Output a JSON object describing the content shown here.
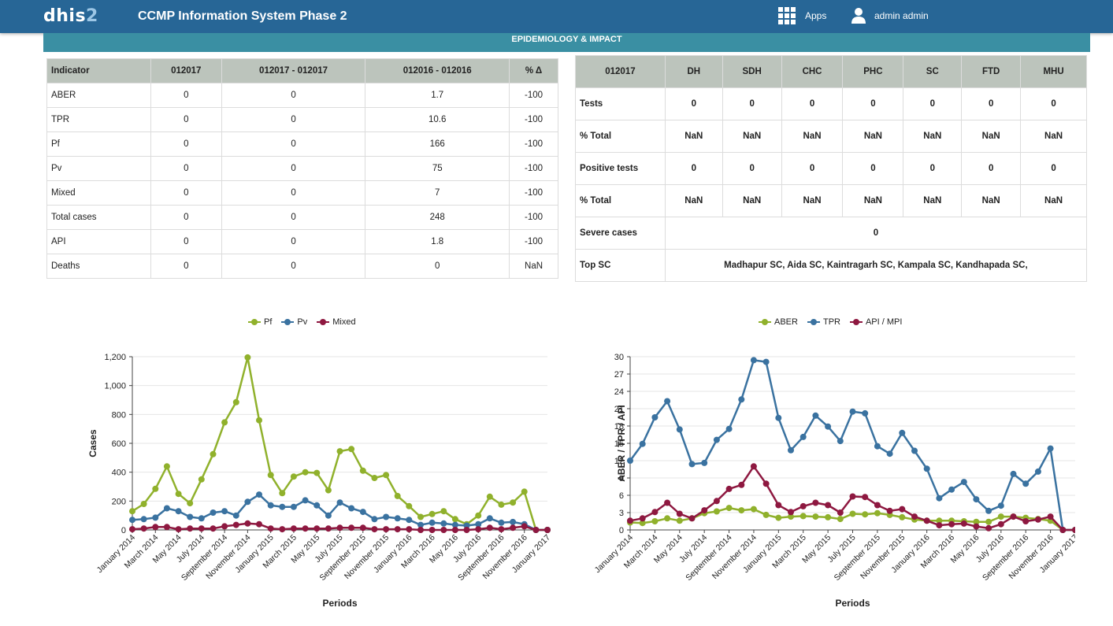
{
  "header": {
    "logo_text": "dhis",
    "logo_digit": "2",
    "title": "CCMP Information System Phase 2",
    "apps_label": "Apps",
    "user_label": "admin admin"
  },
  "banner": {
    "title": "EPIDEMIOLOGY & IMPACT"
  },
  "indicator_table": {
    "headers": [
      "Indicator",
      "012017",
      "012017 - 012017",
      "012016 - 012016",
      "% Δ"
    ],
    "rows": [
      [
        "ABER",
        "0",
        "0",
        "1.7",
        "-100"
      ],
      [
        "TPR",
        "0",
        "0",
        "10.6",
        "-100"
      ],
      [
        "Pf",
        "0",
        "0",
        "166",
        "-100"
      ],
      [
        "Pv",
        "0",
        "0",
        "75",
        "-100"
      ],
      [
        "Mixed",
        "0",
        "0",
        "7",
        "-100"
      ],
      [
        "Total cases",
        "0",
        "0",
        "248",
        "-100"
      ],
      [
        "API",
        "0",
        "0",
        "1.8",
        "-100"
      ],
      [
        "Deaths",
        "0",
        "0",
        "0",
        "NaN"
      ]
    ]
  },
  "facility_table": {
    "headers": [
      "012017",
      "DH",
      "SDH",
      "CHC",
      "PHC",
      "SC",
      "FTD",
      "MHU"
    ],
    "rows": [
      [
        "Tests",
        "0",
        "0",
        "0",
        "0",
        "0",
        "0",
        "0"
      ],
      [
        "% Total",
        "NaN",
        "NaN",
        "NaN",
        "NaN",
        "NaN",
        "NaN",
        "NaN"
      ],
      [
        "Positive tests",
        "0",
        "0",
        "0",
        "0",
        "0",
        "0",
        "0"
      ],
      [
        "% Total",
        "NaN",
        "NaN",
        "NaN",
        "NaN",
        "NaN",
        "NaN",
        "NaN"
      ]
    ],
    "severe_label": "Severe cases",
    "severe_value": "0",
    "top_label": "Top SC",
    "top_value": "Madhapur SC, Aida SC, Kaintragarh SC, Kampala SC, Kandhapada SC,"
  },
  "chart_data": [
    {
      "type": "line",
      "xlabel": "Periods",
      "ylabel": "Cases",
      "ylim": [
        0,
        1200
      ],
      "yticks": [
        0,
        200,
        400,
        600,
        800,
        1000,
        1200
      ],
      "ytick_labels": [
        "0",
        "200",
        "400",
        "600",
        "800",
        "1,000",
        "1,200"
      ],
      "x_labels": [
        "January 2014",
        "March 2014",
        "May 2014",
        "July 2014",
        "September 2014",
        "November 2014",
        "January 2015",
        "March 2015",
        "May 2015",
        "July 2015",
        "September 2015",
        "November 2015",
        "January 2016",
        "March 2016",
        "May 2016",
        "July 2016",
        "September 2016",
        "November 2016",
        "January 2017"
      ],
      "legend_position": "top",
      "grid": true,
      "series": [
        {
          "name": "Pf",
          "color": "#90b12c",
          "values": [
            130,
            180,
            285,
            440,
            250,
            185,
            350,
            525,
            745,
            885,
            1195,
            760,
            380,
            255,
            370,
            400,
            395,
            275,
            545,
            560,
            410,
            360,
            380,
            235,
            165,
            90,
            110,
            130,
            75,
            40,
            100,
            230,
            175,
            190,
            265,
            0,
            0
          ]
        },
        {
          "name": "Pv",
          "color": "#3a72a0",
          "values": [
            70,
            75,
            85,
            150,
            130,
            90,
            80,
            120,
            130,
            100,
            195,
            245,
            170,
            160,
            160,
            205,
            170,
            100,
            190,
            150,
            125,
            75,
            90,
            80,
            70,
            35,
            50,
            45,
            35,
            30,
            40,
            80,
            50,
            55,
            40,
            0,
            0
          ]
        },
        {
          "name": "Mixed",
          "color": "#8e1840",
          "values": [
            5,
            10,
            20,
            20,
            5,
            10,
            10,
            10,
            25,
            35,
            45,
            40,
            10,
            5,
            10,
            10,
            10,
            10,
            15,
            15,
            15,
            5,
            5,
            5,
            5,
            0,
            0,
            0,
            0,
            0,
            5,
            15,
            5,
            15,
            25,
            0,
            0
          ]
        }
      ]
    },
    {
      "type": "line",
      "xlabel": "Periods",
      "ylabel": "ABER / TPR / API",
      "ylim": [
        0,
        30
      ],
      "yticks": [
        0,
        3,
        6,
        9,
        12,
        15,
        18,
        21,
        24,
        27,
        30
      ],
      "ytick_labels": [
        "0",
        "3",
        "6",
        "9",
        "12",
        "15",
        "18",
        "21",
        "24",
        "27",
        "30"
      ],
      "x_labels": [
        "January 2014",
        "March 2014",
        "May 2014",
        "July 2014",
        "September 2014",
        "November 2014",
        "January 2015",
        "March 2015",
        "May 2015",
        "July 2015",
        "September 2015",
        "November 2015",
        "January 2016",
        "March 2016",
        "May 2016",
        "July 2016",
        "September 2016",
        "November 2016",
        "January 2017"
      ],
      "legend_position": "top",
      "grid": true,
      "series": [
        {
          "name": "ABER",
          "color": "#90b12c",
          "values": [
            1.3,
            1.2,
            1.5,
            2.0,
            1.6,
            2.0,
            2.9,
            3.2,
            3.8,
            3.4,
            3.6,
            2.6,
            2.1,
            2.3,
            2.4,
            2.3,
            2.2,
            1.9,
            2.8,
            2.7,
            2.9,
            2.6,
            2.2,
            1.8,
            1.6,
            1.6,
            1.6,
            1.5,
            1.4,
            1.4,
            2.3,
            2.3,
            2.1,
            1.9,
            1.6,
            0,
            0
          ]
        },
        {
          "name": "TPR",
          "color": "#3a72a0",
          "values": [
            12.0,
            14.9,
            19.5,
            22.3,
            17.4,
            11.4,
            11.6,
            15.6,
            17.5,
            22.6,
            29.4,
            29.1,
            19.4,
            13.8,
            16.1,
            19.8,
            17.9,
            15.4,
            20.5,
            20.2,
            14.5,
            13.2,
            16.8,
            13.7,
            10.6,
            5.5,
            7.0,
            8.3,
            5.3,
            3.3,
            4.2,
            9.7,
            8.0,
            10.1,
            14.1,
            0,
            0
          ]
        },
        {
          "name": "API / MPI",
          "color": "#8e1840",
          "values": [
            1.6,
            2.0,
            3.1,
            4.7,
            2.8,
            2.0,
            3.4,
            5.0,
            7.1,
            7.8,
            11.0,
            8.0,
            4.3,
            3.1,
            4.1,
            4.7,
            4.3,
            3.0,
            5.8,
            5.7,
            4.3,
            3.3,
            3.6,
            2.3,
            1.6,
            0.8,
            1.0,
            1.1,
            0.6,
            0.3,
            1.0,
            2.3,
            1.5,
            1.8,
            2.3,
            0,
            0
          ]
        }
      ]
    }
  ]
}
